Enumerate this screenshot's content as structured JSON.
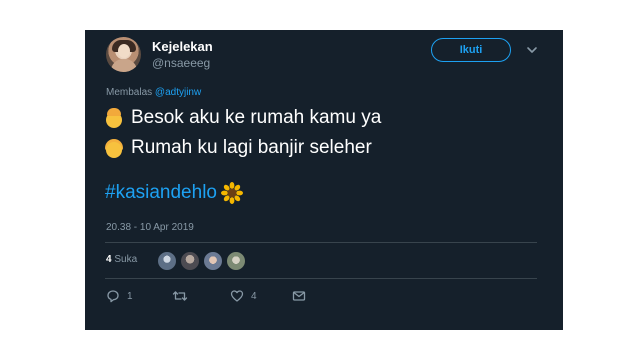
{
  "user": {
    "display_name": "Kejelekan",
    "handle": "@nsaeeeg"
  },
  "follow_label": "Ikuti",
  "reply_to": {
    "prefix": "Membalas",
    "mention": "@adtyjinw"
  },
  "tweet": {
    "line1": "Besok aku ke rumah kamu ya",
    "line2": "Rumah ku lagi banjir seleher",
    "hashtag": "#kasiandehlo"
  },
  "timestamp": "20.38 - 10 Apr 2019",
  "likes": {
    "count": "4",
    "label": "Suka"
  },
  "actions": {
    "reply_count": "1",
    "retweet_count": "",
    "like_count": "4"
  },
  "icons": [
    "chevron-down-icon",
    "boy-emoji-icon",
    "girl-emoji-icon",
    "sunflower-icon",
    "reply-icon",
    "retweet-icon",
    "heart-icon",
    "message-icon"
  ],
  "colors": {
    "background": "#15202b",
    "accent": "#1da1f2",
    "secondary_text": "#8899a6",
    "divider": "#38444d"
  }
}
